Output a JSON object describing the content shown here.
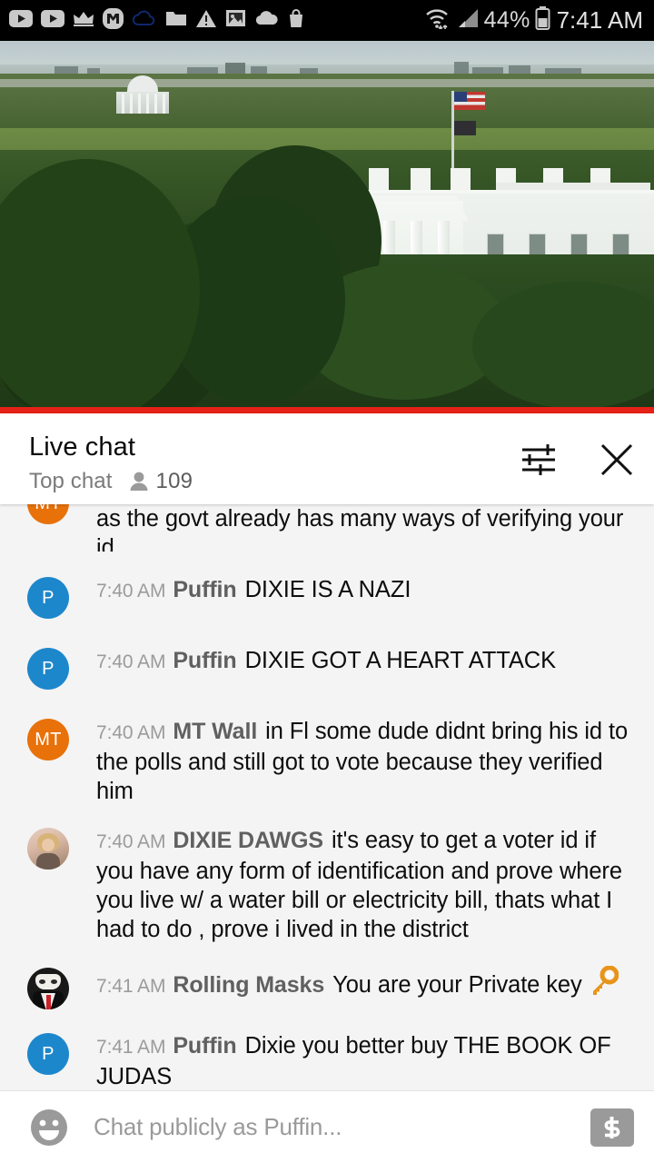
{
  "status_bar": {
    "icons": [
      {
        "name": "youtube-icon"
      },
      {
        "name": "youtube-icon"
      },
      {
        "name": "crown-icon"
      },
      {
        "name": "mega-icon"
      },
      {
        "name": "cloud-outline-icon"
      },
      {
        "name": "folder-icon"
      },
      {
        "name": "warning-triangle-icon"
      },
      {
        "name": "image-icon"
      },
      {
        "name": "cloud-icon"
      },
      {
        "name": "shopping-bag-icon"
      }
    ],
    "wifi_icon": "wifi-icon",
    "signal_icon": "cellular-signal-icon",
    "battery_percent": "44%",
    "battery_icon": "battery-icon",
    "clock": "7:41 AM"
  },
  "video": {
    "name": "white-house-live-stream",
    "progress_percent": 100,
    "progress_color": "#e62117"
  },
  "chat_header": {
    "title": "Live chat",
    "mode": "Top chat",
    "viewer_icon": "person-icon",
    "viewer_count": "109",
    "settings_icon": "tune-sliders-icon",
    "close_icon": "close-icon"
  },
  "messages": [
    {
      "id": "msg-partial",
      "avatar_type": "initials",
      "avatar_text": "MT",
      "avatar_color": "#e8710a",
      "timestamp": "",
      "author": "",
      "text": "as the govt already has many ways of verifying your id",
      "partial": true
    },
    {
      "id": "msg-1",
      "avatar_type": "initials",
      "avatar_text": "P",
      "avatar_color": "#1d87cc",
      "timestamp": "7:40 AM",
      "author": "Puffin",
      "text": "DIXIE IS A NAZI"
    },
    {
      "id": "msg-2",
      "avatar_type": "initials",
      "avatar_text": "P",
      "avatar_color": "#1d87cc",
      "timestamp": "7:40 AM",
      "author": "Puffin",
      "text": "DIXIE GOT A HEART ATTACK"
    },
    {
      "id": "msg-3",
      "avatar_type": "initials",
      "avatar_text": "MT",
      "avatar_color": "#e8710a",
      "timestamp": "7:40 AM",
      "author": "MT Wall",
      "text": "in Fl some dude didnt bring his id to the polls and still got to vote because they verified him"
    },
    {
      "id": "msg-4",
      "avatar_type": "photo",
      "avatar_text": "",
      "avatar_color": "#d9b9a6",
      "timestamp": "7:40 AM",
      "author": "DIXIE DAWGS",
      "text": "it's easy to get a voter id if you have any form of identification and prove where you live w/ a water bill or electricity bill, thats what I had to do , prove i lived in the district"
    },
    {
      "id": "msg-5",
      "avatar_type": "mask",
      "avatar_text": "",
      "avatar_color": "#191919",
      "timestamp": "7:41 AM",
      "author": "Rolling Masks",
      "text": "You are your Private key",
      "emoji": "key-emoji"
    },
    {
      "id": "msg-6",
      "avatar_type": "initials",
      "avatar_text": "P",
      "avatar_color": "#1d87cc",
      "timestamp": "7:41 AM",
      "author": "Puffin",
      "text": "Dixie you better buy THE BOOK OF JUDAS"
    }
  ],
  "input_bar": {
    "emoji_icon": "emoji-smiley-icon",
    "placeholder": "Chat publicly as Puffin...",
    "superchat_icon": "dollar-superchat-icon"
  }
}
